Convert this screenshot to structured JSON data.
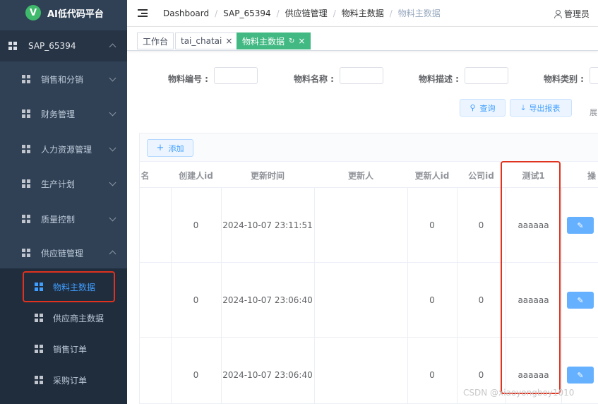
{
  "app": {
    "logo_letter": "V",
    "logo_text": "AI低代码平台"
  },
  "sidebar": {
    "root": {
      "label": "SAP_65394"
    },
    "items": [
      {
        "label": "销售和分销"
      },
      {
        "label": "财务管理"
      },
      {
        "label": "人力资源管理"
      },
      {
        "label": "生产计划"
      },
      {
        "label": "质量控制"
      },
      {
        "label": "供应链管理"
      }
    ],
    "sub_items": [
      {
        "label": "物料主数据",
        "active": true
      },
      {
        "label": "供应商主数据"
      },
      {
        "label": "销售订单"
      },
      {
        "label": "采购订单"
      }
    ]
  },
  "header": {
    "breadcrumb": [
      "Dashboard",
      "SAP_65394",
      "供应链管理",
      "物料主数据",
      "物料主数据"
    ],
    "user": "管理员"
  },
  "tags": [
    {
      "label": "工作台"
    },
    {
      "label": "tai_chatai",
      "close": "×"
    },
    {
      "label": "物料主数据",
      "refresh": "↻",
      "close": "×",
      "active": true
    }
  ],
  "search": {
    "fields": [
      {
        "label": "物料编号 :"
      },
      {
        "label": "物料名称 :"
      },
      {
        "label": "物料描述 :"
      },
      {
        "label": "物料类别 :"
      }
    ],
    "query_label": "查询",
    "export_label": "导出报表",
    "side_hint": "展"
  },
  "table": {
    "add_label": "添加",
    "columns": [
      "名",
      "创建人id",
      "更新时间",
      "更新人",
      "更新人id",
      "公司id",
      "测试1",
      "操"
    ],
    "rows": [
      {
        "creator_id": "0",
        "updated_at": "2024-10-07 23:11:51",
        "updater": "",
        "updater_id": "0",
        "company_id": "0",
        "test1": "aaaaaa"
      },
      {
        "creator_id": "0",
        "updated_at": "2024-10-07 23:06:40",
        "updater": "",
        "updater_id": "0",
        "company_id": "0",
        "test1": "aaaaaa"
      },
      {
        "creator_id": "0",
        "updated_at": "2024-10-07 23:06:40",
        "updater": "",
        "updater_id": "0",
        "company_id": "0",
        "test1": "aaaaaa"
      }
    ]
  },
  "watermark": "CSDN @xiaoyongboy1010",
  "colors": {
    "sidebar_bg": "#304156",
    "accent": "#409eff",
    "tag_active": "#42b983",
    "highlight": "#e0321e"
  }
}
